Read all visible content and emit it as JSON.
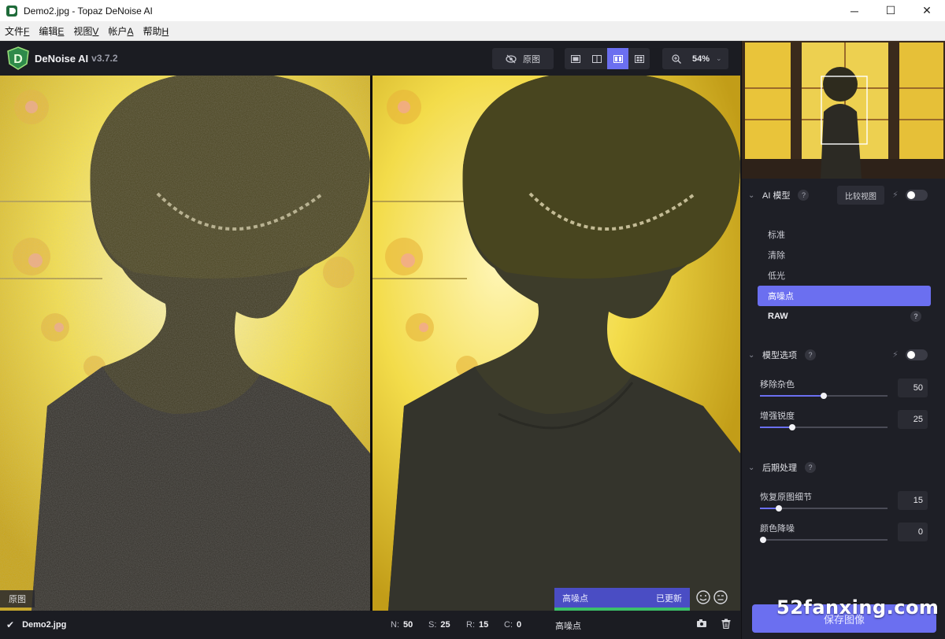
{
  "window": {
    "title": "Demo2.jpg - Topaz DeNoise AI",
    "minimize": "─",
    "maximize": "☐",
    "close": "✕"
  },
  "menu": [
    {
      "label": "文件",
      "key": "F"
    },
    {
      "label": "编辑",
      "key": "E"
    },
    {
      "label": "视图",
      "key": "V"
    },
    {
      "label": "帐户",
      "key": "A"
    },
    {
      "label": "帮助",
      "key": "H"
    }
  ],
  "brand": {
    "name": "DeNoise AI",
    "version": "v3.7.2",
    "logo_letter": "D"
  },
  "toolbar": {
    "original_label": "原图",
    "zoom": "54%"
  },
  "image": {
    "original_label": "原图"
  },
  "model_status": {
    "model": "高噪点",
    "state": "已更新"
  },
  "status": {
    "filename": "Demo2.jpg",
    "stats": [
      {
        "key": "N:",
        "value": "50"
      },
      {
        "key": "S:",
        "value": "25"
      },
      {
        "key": "R:",
        "value": "15"
      },
      {
        "key": "C:",
        "value": "0"
      }
    ],
    "model": "高噪点"
  },
  "panel": {
    "ai_model": {
      "title": "AI 模型",
      "compare_button": "比较视图",
      "items": [
        "标准",
        "清除",
        "低光",
        "高噪点",
        "RAW"
      ],
      "selected_index": 3
    },
    "model_options": {
      "title": "模型选项",
      "sliders": [
        {
          "label": "移除杂色",
          "value": "50",
          "fraction": 0.5
        },
        {
          "label": "增强锐度",
          "value": "25",
          "fraction": 0.25
        }
      ]
    },
    "post_processing": {
      "title": "后期处理",
      "sliders": [
        {
          "label": "恢复原图细节",
          "value": "15",
          "fraction": 0.15
        },
        {
          "label": "颜色降噪",
          "value": "0",
          "fraction": 0.0
        }
      ]
    },
    "save_button": "保存图像"
  },
  "help_mark": "?",
  "watermark": "52fanxing.com",
  "colors": {
    "accent": "#6b6ff0",
    "status_green": "#3bbf6a"
  }
}
